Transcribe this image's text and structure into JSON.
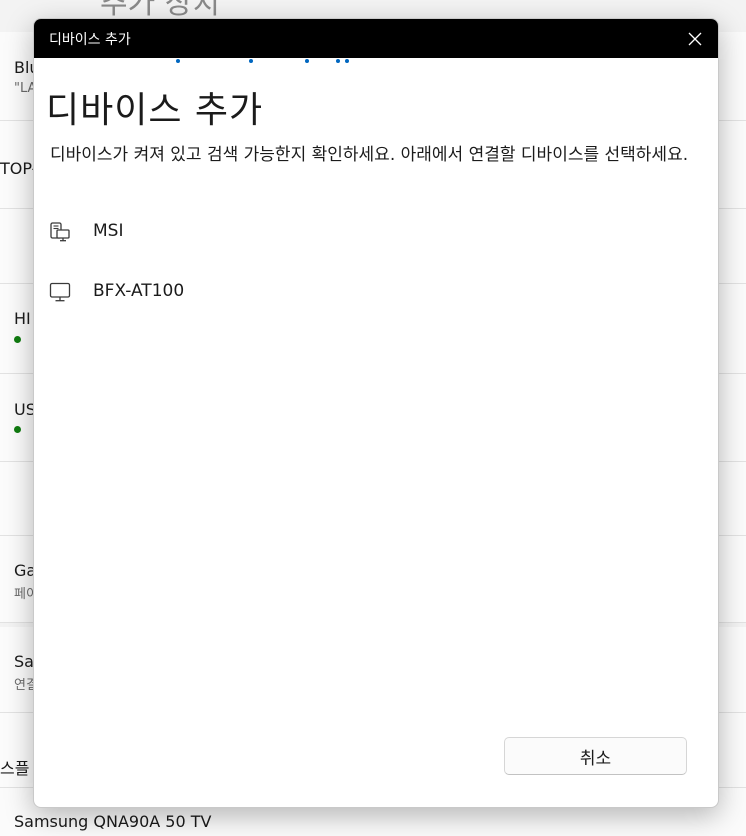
{
  "background": {
    "page_title": "추가 장치",
    "rows": [
      {
        "line1": "Blu",
        "line2": "\"LA"
      },
      {
        "line1": "TOP-",
        "line2": ""
      },
      {
        "line1": "",
        "line2": ""
      },
      {
        "line1": "HI",
        "line2": ""
      },
      {
        "line1": "US",
        "line2": ""
      },
      {
        "line1": "",
        "line2": ""
      },
      {
        "line1": "Ga",
        "line2": "페이"
      },
      {
        "line1": "Sa",
        "line2": "연결"
      },
      {
        "line1": "스플",
        "line2": ""
      },
      {
        "line1": "Samsung QNA90A 50 TV",
        "line2": ""
      }
    ],
    "status_color": "#107c10"
  },
  "dialog": {
    "window_title": "디바이스 추가",
    "heading": "디바이스 추가",
    "instruction": "디바이스가 켜져 있고 검색 가능한지 확인하세요. 아래에서 연결할 디바이스를 선택하세요.",
    "devices": [
      {
        "name": "MSI",
        "icon": "computer-phone-icon"
      },
      {
        "name": "BFX-AT100",
        "icon": "monitor-icon"
      }
    ],
    "cancel_label": "취소",
    "accent_color": "#0067c0"
  }
}
